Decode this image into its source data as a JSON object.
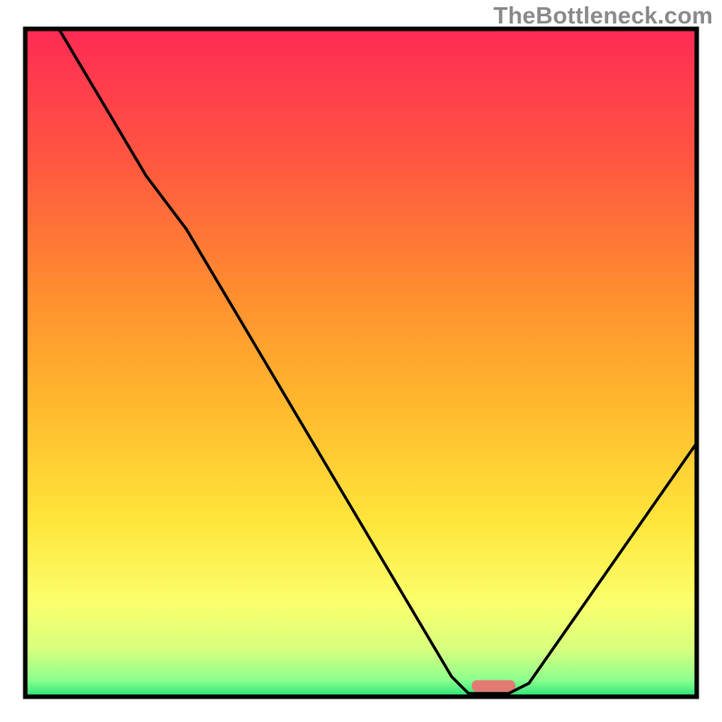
{
  "watermark": "TheBottleneck.com",
  "chart_data": {
    "type": "line",
    "title": "",
    "xlabel": "",
    "ylabel": "",
    "xlim": [
      0,
      100
    ],
    "ylim": [
      0,
      100
    ],
    "grid": false,
    "legend": false,
    "background_gradient_stops": [
      {
        "offset": 0.0,
        "color": "#ff2a55"
      },
      {
        "offset": 0.2,
        "color": "#ff5740"
      },
      {
        "offset": 0.4,
        "color": "#ff8f2f"
      },
      {
        "offset": 0.58,
        "color": "#ffbd2e"
      },
      {
        "offset": 0.74,
        "color": "#ffe63b"
      },
      {
        "offset": 0.86,
        "color": "#fbff6d"
      },
      {
        "offset": 0.93,
        "color": "#d6ff7e"
      },
      {
        "offset": 0.975,
        "color": "#8cff8e"
      },
      {
        "offset": 1.0,
        "color": "#27e576"
      }
    ],
    "curve_points": [
      {
        "x": 5.0,
        "y": 100.0
      },
      {
        "x": 18.0,
        "y": 78.0
      },
      {
        "x": 24.0,
        "y": 70.0
      },
      {
        "x": 63.5,
        "y": 3.0
      },
      {
        "x": 66.0,
        "y": 0.5
      },
      {
        "x": 72.0,
        "y": 0.5
      },
      {
        "x": 75.0,
        "y": 2.0
      },
      {
        "x": 100.0,
        "y": 38.0
      }
    ],
    "highlight_bar": {
      "x_start": 66.5,
      "x_end": 73.0,
      "y": 1.6,
      "color": "#e47a74"
    },
    "frame_color": "#000000",
    "curve_stroke_width": 3.2
  }
}
